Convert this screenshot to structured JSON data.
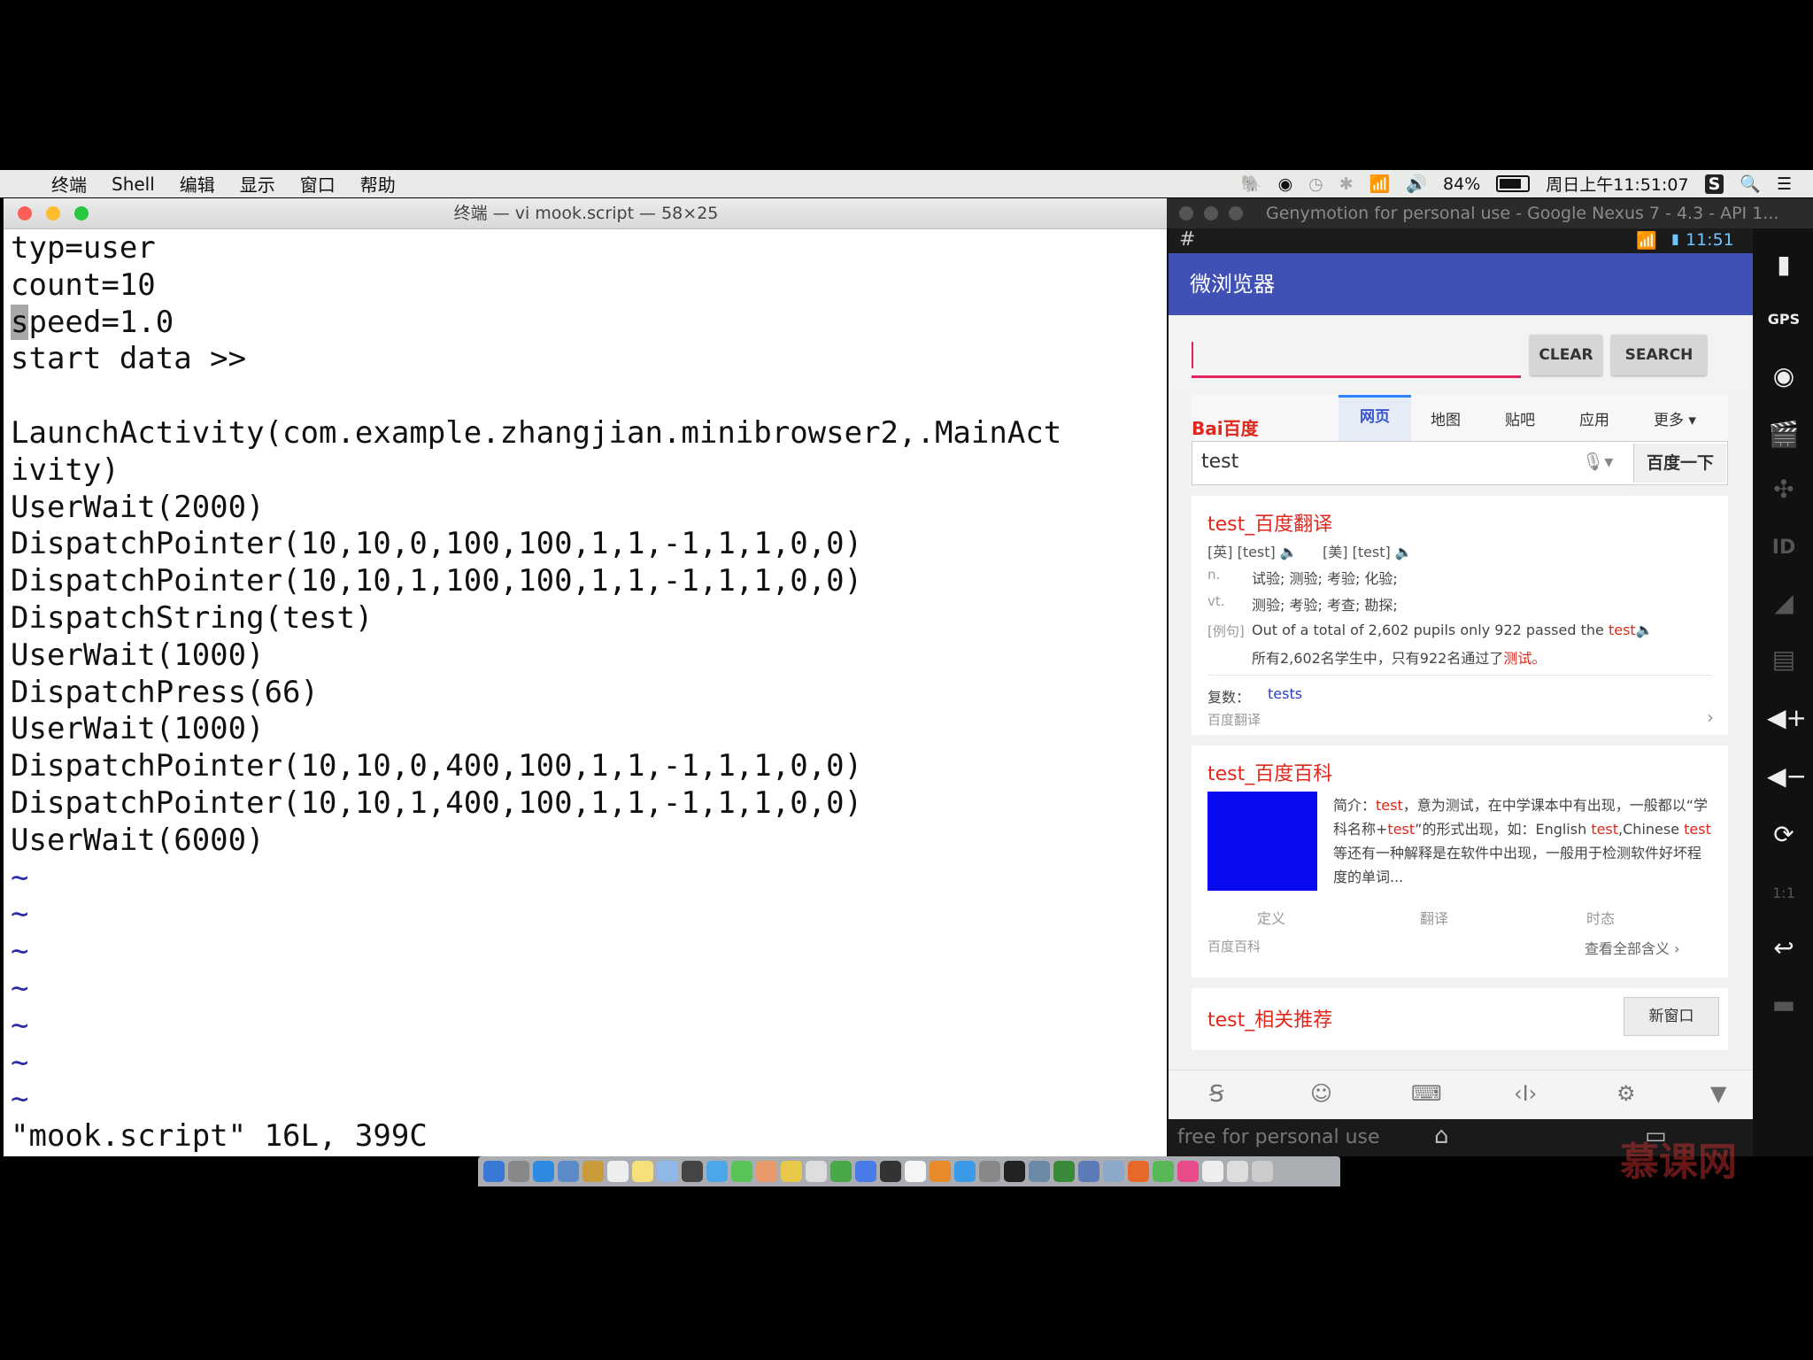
{
  "menubar": {
    "app_menus": [
      "终端",
      "Shell",
      "编辑",
      "显示",
      "窗口",
      "帮助"
    ],
    "battery": "84%",
    "clock": "周日上午11:51:07"
  },
  "terminal": {
    "title": "终端 — vi mook.script — 58×25",
    "lines": [
      "typ=user",
      "count=10",
      "speed=1.0",
      "start data >>",
      "",
      "LaunchActivity(com.example.zhangjian.minibrowser2,.MainAct",
      "ivity)",
      "UserWait(2000)",
      "DispatchPointer(10,10,0,100,100,1,1,-1,1,1,0,0)",
      "DispatchPointer(10,10,1,100,100,1,1,-1,1,1,0,0)",
      "DispatchString(test)",
      "UserWait(1000)",
      "DispatchPress(66)",
      "UserWait(1000)",
      "DispatchPointer(10,10,0,400,100,1,1,-1,1,1,0,0)",
      "DispatchPointer(10,10,1,400,100,1,1,-1,1,1,0,0)",
      "UserWait(6000)",
      "~",
      "~",
      "~",
      "~",
      "~",
      "~",
      "~"
    ],
    "status_line": "\"mook.script\" 16L, 399C"
  },
  "genymotion": {
    "title": "Genymotion for personal use - Google Nexus 7 - 4.3 - API 1...",
    "status_time": "11:51",
    "app_title": "微浏览器",
    "clear_label": "CLEAR",
    "search_label": "SEARCH",
    "baidu": {
      "logo": "Bai百度",
      "tabs": [
        "网页",
        "地图",
        "贴吧",
        "应用",
        "更多 ▾"
      ],
      "query": "test",
      "search_btn": "百度一下",
      "result1": {
        "title": "test_百度翻译",
        "phonetic_en": "[英] [test]",
        "phonetic_us": "[美] [test]",
        "n_label": "n.",
        "n_text": "试验; 测验; 考验; 化验;",
        "vt_label": "vt.",
        "vt_text": "测验; 考验; 考查; 勘探;",
        "example_label": "[例句]",
        "example_en": "Out of a total of 2,602 pupils only 922 passed the ",
        "example_em": "test",
        "example_zh": "所有2,602名学生中，只有922名通过了",
        "example_zh_em": "测试。",
        "plural_label": "复数：",
        "plural": "tests",
        "source": "百度翻译"
      },
      "result2": {
        "title": "test_百度百科",
        "intro_1": "简介：",
        "intro_2": "test",
        "intro_3": "，意为测试，在中学课本中有出现，",
        "intro_4": "一般都以“学科名称+",
        "intro_5": "test",
        "intro_6": "”的形式出现，如：",
        "intro_7": "English ",
        "intro_8": "test",
        "intro_9": ",Chinese ",
        "intro_10": "test",
        "intro_11": "等还有一种解释是在软",
        "intro_12": "件中出现，一般用于检测软件好坏程度的单词...",
        "tabs": [
          "定义",
          "翻译",
          "时态"
        ],
        "source": "百度百科",
        "more": "查看全部含义 ›"
      },
      "result3": {
        "title": "test_相关推荐",
        "new_window": "新窗口"
      }
    },
    "footer": "free for personal use"
  },
  "watermark": "慕课网"
}
